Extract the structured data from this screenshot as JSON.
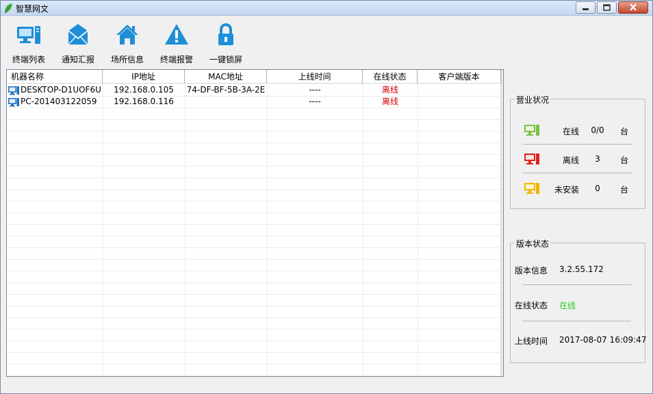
{
  "window": {
    "title": "智慧网文"
  },
  "toolbar": {
    "items": [
      {
        "label": "终端列表",
        "icon": "monitor-icon"
      },
      {
        "label": "通知汇报",
        "icon": "envelope-icon"
      },
      {
        "label": "场所信息",
        "icon": "home-icon"
      },
      {
        "label": "终端报警",
        "icon": "warning-icon"
      },
      {
        "label": "一键锁屏",
        "icon": "lock-icon"
      }
    ]
  },
  "grid": {
    "columns": [
      "机器名称",
      "IP地址",
      "MAC地址",
      "上线时间",
      "在线状态",
      "客户端版本"
    ],
    "rows": [
      {
        "name": "DESKTOP-D1UOF6U",
        "ip": "192.168.0.105",
        "mac": "74-DF-BF-5B-3A-2E",
        "online_time": "----",
        "status": "离线",
        "version": ""
      },
      {
        "name": "PC-201403122059",
        "ip": "192.168.0.116",
        "mac": "",
        "online_time": "----",
        "status": "离线",
        "version": ""
      }
    ]
  },
  "business": {
    "title": "营业状况",
    "online": {
      "label": "在线",
      "value": "0/0",
      "unit": "台",
      "color": "#7dc242"
    },
    "offline": {
      "label": "离线",
      "value": "3",
      "unit": "台",
      "color": "#e02020"
    },
    "not_installed": {
      "label": "未安装",
      "value": "0",
      "unit": "台",
      "color": "#f0b400"
    }
  },
  "version_status": {
    "title": "版本状态",
    "info_label": "版本信息",
    "info_value": "3.2.55.172",
    "status_label": "在线状态",
    "status_value": "在线",
    "time_label": "上线时间",
    "time_value": "2017-08-07 16:09:47"
  }
}
